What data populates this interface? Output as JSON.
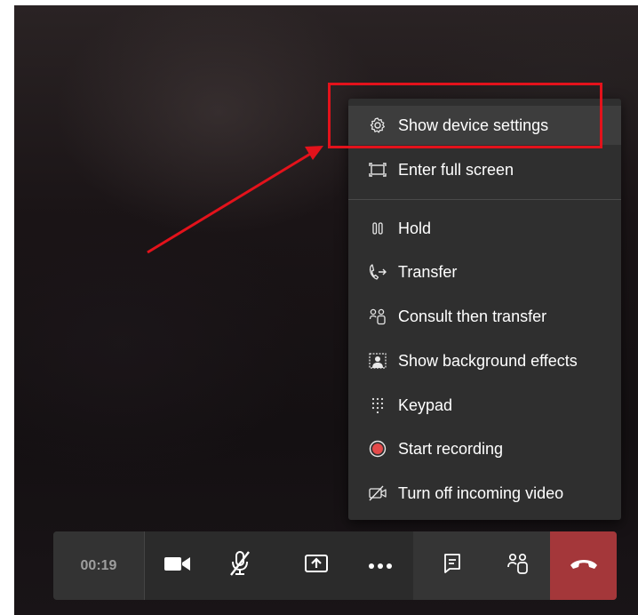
{
  "menu": {
    "items": [
      {
        "label": "Show device settings",
        "icon": "gear-icon"
      },
      {
        "label": "Enter full screen",
        "icon": "fullscreen-icon"
      },
      {
        "label": "Hold",
        "icon": "pause-icon"
      },
      {
        "label": "Transfer",
        "icon": "transfer-icon"
      },
      {
        "label": "Consult then transfer",
        "icon": "consult-icon"
      },
      {
        "label": "Show background effects",
        "icon": "background-effects-icon"
      },
      {
        "label": "Keypad",
        "icon": "keypad-icon"
      },
      {
        "label": "Start recording",
        "icon": "record-icon"
      },
      {
        "label": "Turn off incoming video",
        "icon": "video-off-icon"
      }
    ]
  },
  "toolbar": {
    "timer": "00:19",
    "buttons": [
      "camera-icon",
      "mic-muted-icon",
      "share-screen-icon",
      "more-icon",
      "chat-icon",
      "participants-icon",
      "hang-up-icon"
    ]
  },
  "colors": {
    "menu_bg": "#2f2f2f",
    "toolbar_bg": "#2b2b2b",
    "hangup": "#a4373a",
    "record": "#e34a4a",
    "annotation": "#e3121b"
  }
}
